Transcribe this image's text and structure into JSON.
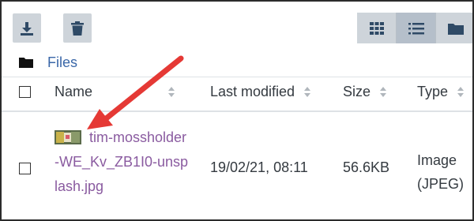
{
  "toolbar": {
    "download_icon": "download-icon",
    "delete_icon": "trash-icon",
    "views": [
      {
        "name": "grid-view-icon",
        "active": false
      },
      {
        "name": "list-view-icon",
        "active": true
      },
      {
        "name": "tree-view-icon",
        "active": false
      }
    ]
  },
  "breadcrumb": {
    "icon": "folder-icon",
    "label": "Files"
  },
  "table": {
    "columns": [
      "Name",
      "Last modified",
      "Size",
      "Type"
    ],
    "rows": [
      {
        "name": "tim-mossholder-WE_Kv_ZB1I0-unsplash.jpg",
        "modified": "19/02/21, 08:11",
        "size": "56.6KB",
        "type_line1": "Image",
        "type_line2": "(JPEG)",
        "thumbnail": "image-thumbnail-icon"
      }
    ]
  },
  "colors": {
    "button_bg": "#ced4da",
    "link": "#3a67a8",
    "filename": "#8a5ba0",
    "annotation_arrow": "#e53935"
  }
}
